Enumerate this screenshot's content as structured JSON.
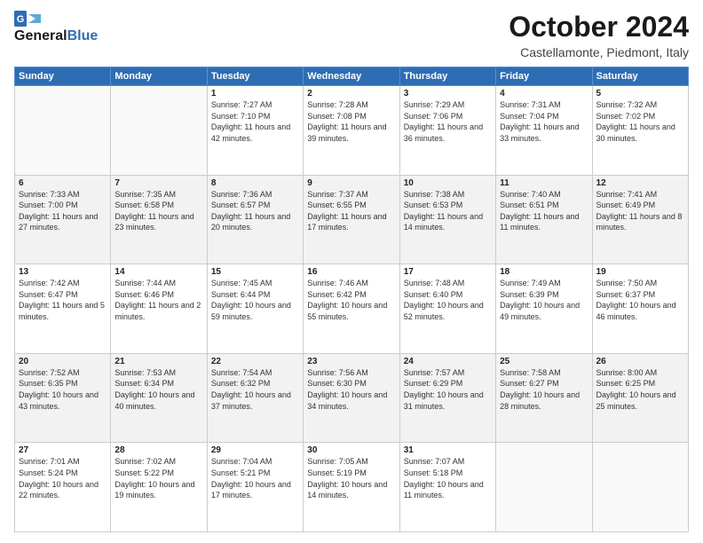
{
  "header": {
    "logo_line1": "General",
    "logo_line2": "Blue",
    "month": "October 2024",
    "location": "Castellamonte, Piedmont, Italy"
  },
  "weekdays": [
    "Sunday",
    "Monday",
    "Tuesday",
    "Wednesday",
    "Thursday",
    "Friday",
    "Saturday"
  ],
  "weeks": [
    [
      {
        "day": "",
        "detail": ""
      },
      {
        "day": "",
        "detail": ""
      },
      {
        "day": "1",
        "detail": "Sunrise: 7:27 AM\nSunset: 7:10 PM\nDaylight: 11 hours and 42 minutes."
      },
      {
        "day": "2",
        "detail": "Sunrise: 7:28 AM\nSunset: 7:08 PM\nDaylight: 11 hours and 39 minutes."
      },
      {
        "day": "3",
        "detail": "Sunrise: 7:29 AM\nSunset: 7:06 PM\nDaylight: 11 hours and 36 minutes."
      },
      {
        "day": "4",
        "detail": "Sunrise: 7:31 AM\nSunset: 7:04 PM\nDaylight: 11 hours and 33 minutes."
      },
      {
        "day": "5",
        "detail": "Sunrise: 7:32 AM\nSunset: 7:02 PM\nDaylight: 11 hours and 30 minutes."
      }
    ],
    [
      {
        "day": "6",
        "detail": "Sunrise: 7:33 AM\nSunset: 7:00 PM\nDaylight: 11 hours and 27 minutes."
      },
      {
        "day": "7",
        "detail": "Sunrise: 7:35 AM\nSunset: 6:58 PM\nDaylight: 11 hours and 23 minutes."
      },
      {
        "day": "8",
        "detail": "Sunrise: 7:36 AM\nSunset: 6:57 PM\nDaylight: 11 hours and 20 minutes."
      },
      {
        "day": "9",
        "detail": "Sunrise: 7:37 AM\nSunset: 6:55 PM\nDaylight: 11 hours and 17 minutes."
      },
      {
        "day": "10",
        "detail": "Sunrise: 7:38 AM\nSunset: 6:53 PM\nDaylight: 11 hours and 14 minutes."
      },
      {
        "day": "11",
        "detail": "Sunrise: 7:40 AM\nSunset: 6:51 PM\nDaylight: 11 hours and 11 minutes."
      },
      {
        "day": "12",
        "detail": "Sunrise: 7:41 AM\nSunset: 6:49 PM\nDaylight: 11 hours and 8 minutes."
      }
    ],
    [
      {
        "day": "13",
        "detail": "Sunrise: 7:42 AM\nSunset: 6:47 PM\nDaylight: 11 hours and 5 minutes."
      },
      {
        "day": "14",
        "detail": "Sunrise: 7:44 AM\nSunset: 6:46 PM\nDaylight: 11 hours and 2 minutes."
      },
      {
        "day": "15",
        "detail": "Sunrise: 7:45 AM\nSunset: 6:44 PM\nDaylight: 10 hours and 59 minutes."
      },
      {
        "day": "16",
        "detail": "Sunrise: 7:46 AM\nSunset: 6:42 PM\nDaylight: 10 hours and 55 minutes."
      },
      {
        "day": "17",
        "detail": "Sunrise: 7:48 AM\nSunset: 6:40 PM\nDaylight: 10 hours and 52 minutes."
      },
      {
        "day": "18",
        "detail": "Sunrise: 7:49 AM\nSunset: 6:39 PM\nDaylight: 10 hours and 49 minutes."
      },
      {
        "day": "19",
        "detail": "Sunrise: 7:50 AM\nSunset: 6:37 PM\nDaylight: 10 hours and 46 minutes."
      }
    ],
    [
      {
        "day": "20",
        "detail": "Sunrise: 7:52 AM\nSunset: 6:35 PM\nDaylight: 10 hours and 43 minutes."
      },
      {
        "day": "21",
        "detail": "Sunrise: 7:53 AM\nSunset: 6:34 PM\nDaylight: 10 hours and 40 minutes."
      },
      {
        "day": "22",
        "detail": "Sunrise: 7:54 AM\nSunset: 6:32 PM\nDaylight: 10 hours and 37 minutes."
      },
      {
        "day": "23",
        "detail": "Sunrise: 7:56 AM\nSunset: 6:30 PM\nDaylight: 10 hours and 34 minutes."
      },
      {
        "day": "24",
        "detail": "Sunrise: 7:57 AM\nSunset: 6:29 PM\nDaylight: 10 hours and 31 minutes."
      },
      {
        "day": "25",
        "detail": "Sunrise: 7:58 AM\nSunset: 6:27 PM\nDaylight: 10 hours and 28 minutes."
      },
      {
        "day": "26",
        "detail": "Sunrise: 8:00 AM\nSunset: 6:25 PM\nDaylight: 10 hours and 25 minutes."
      }
    ],
    [
      {
        "day": "27",
        "detail": "Sunrise: 7:01 AM\nSunset: 5:24 PM\nDaylight: 10 hours and 22 minutes."
      },
      {
        "day": "28",
        "detail": "Sunrise: 7:02 AM\nSunset: 5:22 PM\nDaylight: 10 hours and 19 minutes."
      },
      {
        "day": "29",
        "detail": "Sunrise: 7:04 AM\nSunset: 5:21 PM\nDaylight: 10 hours and 17 minutes."
      },
      {
        "day": "30",
        "detail": "Sunrise: 7:05 AM\nSunset: 5:19 PM\nDaylight: 10 hours and 14 minutes."
      },
      {
        "day": "31",
        "detail": "Sunrise: 7:07 AM\nSunset: 5:18 PM\nDaylight: 10 hours and 11 minutes."
      },
      {
        "day": "",
        "detail": ""
      },
      {
        "day": "",
        "detail": ""
      }
    ]
  ]
}
